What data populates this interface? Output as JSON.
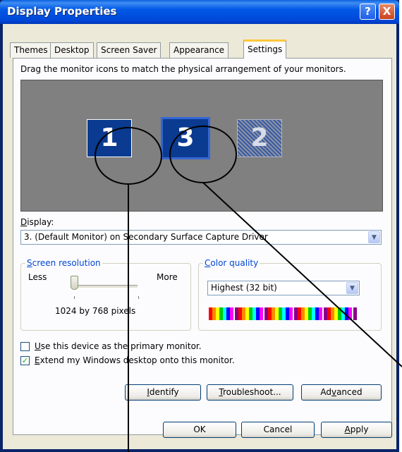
{
  "window": {
    "title": "Display Properties",
    "help_glyph": "?",
    "close_glyph": "X"
  },
  "tabs": [
    {
      "label": "Themes",
      "active": false
    },
    {
      "label": "Desktop",
      "active": false
    },
    {
      "label": "Screen Saver",
      "active": false
    },
    {
      "label": "Appearance",
      "active": false
    },
    {
      "label": "Settings",
      "active": true
    }
  ],
  "settings": {
    "instruction": "Drag the monitor icons to match the physical arrangement of your monitors.",
    "monitors": [
      {
        "number": "1",
        "state": "enabled"
      },
      {
        "number": "3",
        "state": "selected"
      },
      {
        "number": "2",
        "state": "disabled"
      }
    ],
    "display_label_prefix": "D",
    "display_label_rest": "isplay:",
    "display_value": "3. (Default Monitor) on Secondary Surface Capture Driver",
    "resolution": {
      "title_prefix": "S",
      "title_rest": "creen resolution",
      "less": "Less",
      "more": "More",
      "value": "1024 by 768 pixels",
      "slider_level": 0.1
    },
    "color_quality": {
      "title_prefix": "C",
      "title_rest": "olor quality",
      "value": "Highest (32 bit)"
    },
    "primary_checkbox": {
      "prefix": "U",
      "rest": "se this device as the primary monitor.",
      "checked": false
    },
    "extend_checkbox": {
      "prefix": "E",
      "rest": "xtend my Windows desktop onto this monitor.",
      "checked": true
    },
    "buttons": {
      "identify_prefix": "I",
      "identify_rest": "dentify",
      "troubleshoot_prefix": "T",
      "troubleshoot_rest": "roubleshoot...",
      "advanced_a": "Ad",
      "advanced_v": "v",
      "advanced_rest": "anced"
    }
  },
  "footer": {
    "ok": "OK",
    "cancel": "Cancel",
    "apply_prefix": "A",
    "apply_rest": "pply"
  },
  "colors": {
    "title_blue": "#0058e6",
    "panel_bg": "#fcfcfe",
    "monitor_area": "#808080",
    "group_title": "#0046d5"
  }
}
